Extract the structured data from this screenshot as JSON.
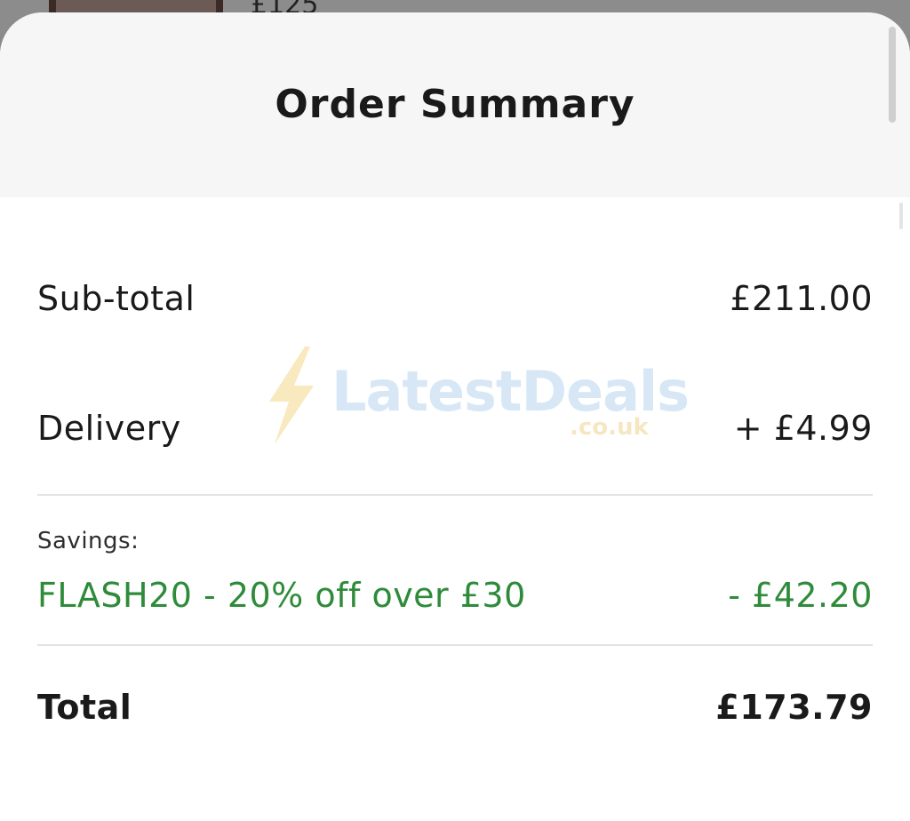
{
  "backdrop": {
    "price_peek": "£125"
  },
  "order_summary": {
    "title": "Order Summary",
    "subtotal": {
      "label": "Sub-total",
      "value": "£211.00"
    },
    "delivery": {
      "label": "Delivery",
      "value": "+ £4.99"
    },
    "savings": {
      "heading": "Savings:",
      "code_label": "FLASH20 - 20% off over £30",
      "value": "- £42.20"
    },
    "total": {
      "label": "Total",
      "value": "£173.79"
    }
  },
  "watermark": {
    "brand": "LatestDeals",
    "domain": ".co.uk",
    "icon": "lightning-bolt-icon"
  },
  "colors": {
    "savings_green": "#2e8b3a",
    "header_bg": "#f6f6f6",
    "text_dark": "#1a1a1a"
  }
}
